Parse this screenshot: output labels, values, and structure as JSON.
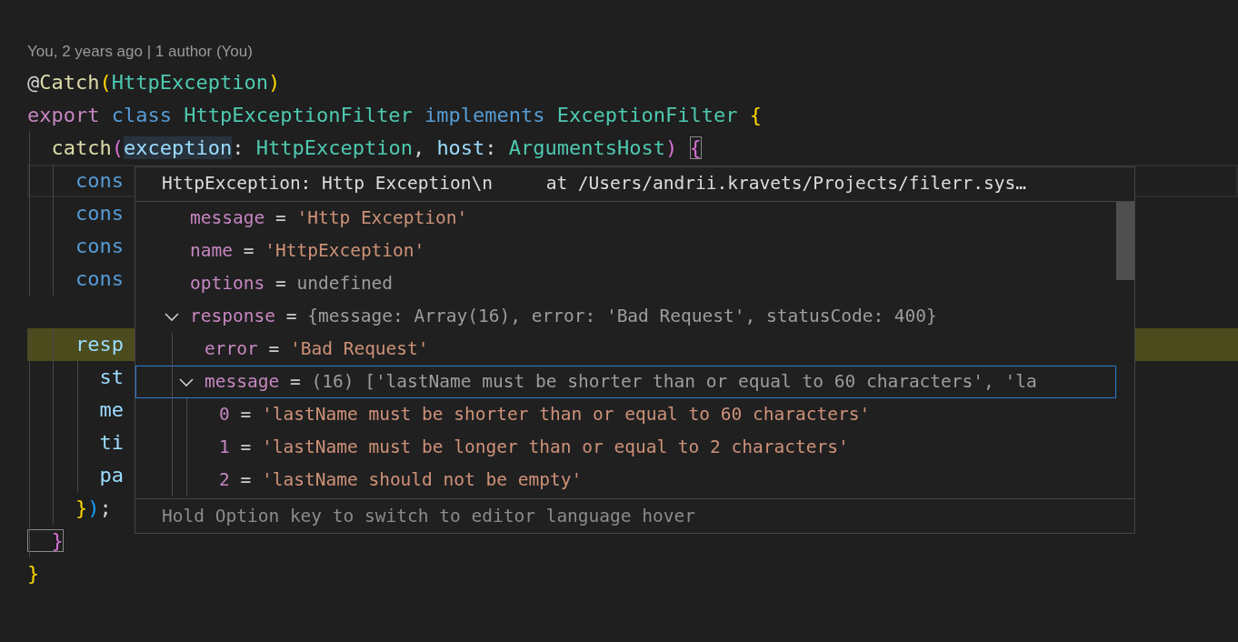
{
  "codelens": "You, 2 years ago | 1 author (You)",
  "code_lines": [
    {
      "current": false,
      "paused": false,
      "tokens": [
        {
          "text": "@",
          "kind": "punct"
        },
        {
          "text": "Catch",
          "kind": "func"
        },
        {
          "text": "(",
          "kind": "bracket1"
        },
        {
          "text": "HttpException",
          "kind": "type"
        },
        {
          "text": ")",
          "kind": "bracket1"
        }
      ]
    },
    {
      "current": false,
      "paused": false,
      "tokens": [
        {
          "text": "export ",
          "kind": "keyword"
        },
        {
          "text": "class ",
          "kind": "storage"
        },
        {
          "text": "HttpExceptionFilter ",
          "kind": "type"
        },
        {
          "text": "implements ",
          "kind": "storage"
        },
        {
          "text": "ExceptionFilter ",
          "kind": "type"
        },
        {
          "text": "{",
          "kind": "bracket1"
        }
      ]
    },
    {
      "current": false,
      "paused": false,
      "tokens": [
        {
          "text": "  catch",
          "kind": "func"
        },
        {
          "text": "(",
          "kind": "bracket2"
        },
        {
          "text": "exception",
          "kind": "param",
          "word_highlight": true
        },
        {
          "text": ": ",
          "kind": "punct"
        },
        {
          "text": "HttpException",
          "kind": "type"
        },
        {
          "text": ", ",
          "kind": "punct"
        },
        {
          "text": "host",
          "kind": "param"
        },
        {
          "text": ": ",
          "kind": "punct"
        },
        {
          "text": "ArgumentsHost",
          "kind": "type"
        },
        {
          "text": ") ",
          "kind": "bracket2"
        },
        {
          "text": "{",
          "kind": "bracket2",
          "bracket_match": true
        }
      ]
    },
    {
      "current": true,
      "paused": false,
      "tokens": [
        {
          "text": "    cons",
          "kind": "storage"
        }
      ]
    },
    {
      "current": false,
      "paused": false,
      "tokens": [
        {
          "text": "    cons",
          "kind": "storage"
        }
      ]
    },
    {
      "current": false,
      "paused": false,
      "tokens": [
        {
          "text": "    cons",
          "kind": "storage"
        }
      ]
    },
    {
      "current": false,
      "paused": false,
      "tokens": [
        {
          "text": "    cons",
          "kind": "storage"
        }
      ]
    },
    {
      "current": false,
      "paused": false
    },
    {
      "current": false,
      "paused": true,
      "tokens": [
        {
          "text": "    resp",
          "kind": "variable"
        }
      ]
    },
    {
      "current": false,
      "paused": false,
      "tokens": [
        {
          "text": "      st",
          "kind": "variable"
        }
      ]
    },
    {
      "current": false,
      "paused": false,
      "tokens": [
        {
          "text": "      me",
          "kind": "variable"
        }
      ]
    },
    {
      "current": false,
      "paused": false,
      "tokens": [
        {
          "text": "      ti",
          "kind": "variable"
        }
      ]
    },
    {
      "current": false,
      "paused": false,
      "tokens": [
        {
          "text": "      pa",
          "kind": "variable"
        }
      ]
    },
    {
      "current": false,
      "paused": false,
      "tokens": [
        {
          "text": "    }",
          "kind": "bracket1"
        },
        {
          "text": ")",
          "kind": "bracket3"
        },
        {
          "text": ";",
          "kind": "punct"
        }
      ]
    },
    {
      "current": false,
      "paused": false,
      "tokens": [
        {
          "text": "  }",
          "kind": "bracket2",
          "bracket_match": true
        }
      ]
    },
    {
      "current": false,
      "paused": false,
      "tokens": [
        {
          "text": "}",
          "kind": "bracket1"
        }
      ]
    }
  ],
  "hover": {
    "header": "HttpException: Http Exception\\n     at /Users/andrii.kravets/Projects/filerr.sys…",
    "tree": [
      {
        "name": "message",
        "op": "=",
        "value": "'Http Exception'",
        "kind": "string",
        "selected": false
      },
      {
        "name": "name",
        "op": "=",
        "value": "'HttpException'",
        "kind": "string",
        "selected": false
      },
      {
        "name": "options",
        "op": "=",
        "value": "undefined",
        "kind": "plain",
        "selected": false
      },
      {
        "name": "response",
        "op": "=",
        "value": "{message: Array(16), error: 'Bad Request', statusCode: 400}",
        "kind": "plain",
        "expanded": true,
        "selected": false,
        "children": [
          {
            "name": "error",
            "op": "=",
            "value": "'Bad Request'",
            "kind": "string",
            "selected": false
          },
          {
            "name": "message",
            "op": "=",
            "value": "(16) ['lastName must be shorter than or equal to 60 characters', 'la",
            "kind": "plain",
            "expanded": true,
            "selected": true,
            "children": [
              {
                "name": "0",
                "op": "=",
                "value": "'lastName must be shorter than or equal to 60 characters'",
                "kind": "string",
                "selected": false
              },
              {
                "name": "1",
                "op": "=",
                "value": "'lastName must be longer than or equal to 2 characters'",
                "kind": "string",
                "selected": false
              },
              {
                "name": "2",
                "op": "=",
                "value": "'lastName should not be empty'",
                "kind": "string",
                "selected": false
              }
            ]
          }
        ]
      }
    ],
    "footer": "Hold Option key to switch to editor language hover"
  }
}
